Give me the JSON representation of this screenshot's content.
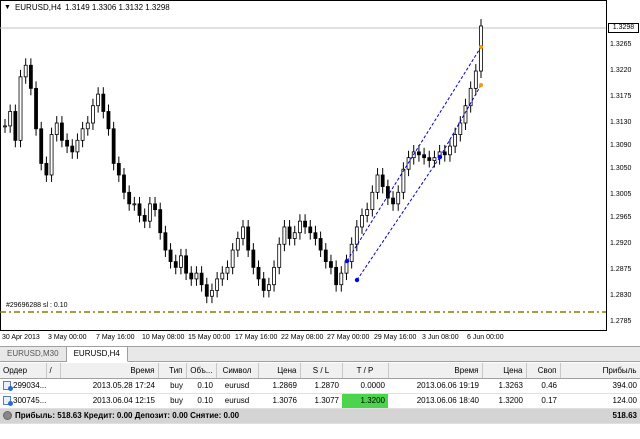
{
  "chart": {
    "header": {
      "menu_glyph": "▼",
      "title": "EURUSD,H4",
      "ohlc": "1.3149 1.3306 1.3132 1.3298"
    },
    "order_line_label": "#29696288 sl : 0.10",
    "current_price": "1.3298",
    "price_axis": [
      {
        "label": "1.3265",
        "value": 1.3265
      },
      {
        "label": "1.3220",
        "value": 1.322
      },
      {
        "label": "1.3175",
        "value": 1.3175
      },
      {
        "label": "1.3130",
        "value": 1.313
      },
      {
        "label": "1.3090",
        "value": 1.309
      },
      {
        "label": "1.3050",
        "value": 1.305
      },
      {
        "label": "1.3005",
        "value": 1.3005
      },
      {
        "label": "1.2965",
        "value": 1.2965
      },
      {
        "label": "1.2920",
        "value": 1.292
      },
      {
        "label": "1.2875",
        "value": 1.2875
      },
      {
        "label": "1.2830",
        "value": 1.283
      },
      {
        "label": "1.2785",
        "value": 1.2785
      }
    ],
    "time_axis": [
      "30 Apr 2013",
      "3 May 00:00",
      "7 May 16:00",
      "10 May 08:00",
      "15 May 00:00",
      "17 May 16:00",
      "22 May 08:00",
      "27 May 00:00",
      "29 May 16:00",
      "3 Jun 08:00",
      "6 Jun 00:00"
    ],
    "colors": {
      "candle": "#000000",
      "order_line": "#8b7a00",
      "trend_line": "#0000cc",
      "marker_buy": "#0000ff",
      "marker_exit": "#ff9900"
    }
  },
  "chart_tabs": [
    {
      "label": "EURUSD,M30",
      "active": false
    },
    {
      "label": "EURUSD,H4",
      "active": true
    }
  ],
  "terminal": {
    "columns": [
      "Ордер",
      "/",
      "Время",
      "Тип",
      "Объ...",
      "Символ",
      "Цена",
      "S / L",
      "T / P",
      "Время",
      "Цена",
      "Своп",
      "Прибыль"
    ],
    "rows": [
      {
        "order": "299034...",
        "open_time": "2013.05.28 17:24",
        "type": "buy",
        "volume": "0.10",
        "symbol": "eurusd",
        "price": "1.2869",
        "sl": "1.2870",
        "tp": "0.0000",
        "close_time": "2013.06.06 19:19",
        "close_price": "1.3263",
        "swap": "0.46",
        "profit": "394.00"
      },
      {
        "order": "300745...",
        "open_time": "2013.06.04 12:15",
        "type": "buy",
        "volume": "0.10",
        "symbol": "eurusd",
        "price": "1.3076",
        "sl": "1.3077",
        "tp": "1.3200",
        "close_time": "2013.06.06 18:40",
        "close_price": "1.3200",
        "swap": "0.17",
        "profit": "124.00"
      }
    ],
    "summary": {
      "text": "Прибыль: 518.63  Кредит: 0.00  Депозит: 0.00  Снятие: 0.00",
      "total": "518.63"
    },
    "colors": {
      "tp_highlight": "#4cd44c",
      "summary_bg": "#d4d4d4"
    }
  }
}
